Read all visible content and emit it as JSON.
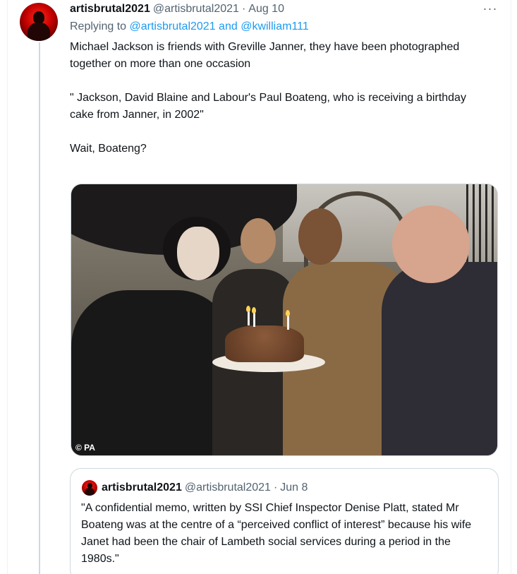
{
  "tweet": {
    "display_name": "artisbrutal2021",
    "handle": "@artisbrutal2021",
    "separator": "·",
    "date": "Aug 10",
    "more_icon": "···",
    "replying_prefix": "Replying to",
    "reply_mention_1": "@artisbrutal2021",
    "reply_and": "and",
    "reply_mention_2": "@kwilliam111",
    "paragraphs": [
      "Michael Jackson is friends with Greville Janner, they have been photographed together on more than one occasion",
      "\" Jackson, David Blaine and Labour's Paul Boateng, who is receiving a birthday cake from Janner, in 2002\"",
      "Wait, Boateng?"
    ],
    "photo_watermark": "© PA"
  },
  "quoted_tweet": {
    "display_name": "artisbrutal2021",
    "handle": "@artisbrutal2021",
    "separator": "·",
    "date": "Jun 8",
    "text": "\"A confidential memo, written by SSI Chief Inspector Denise Platt, stated Mr Boateng was at the centre of a “perceived conflict of interest” because his wife Janet had been the chair of Lambeth social services during a period in the 1980s.\""
  },
  "colors": {
    "text_primary": "#0f1419",
    "text_secondary": "#536471",
    "link": "#1d9bf0",
    "border": "#cfd9de"
  }
}
